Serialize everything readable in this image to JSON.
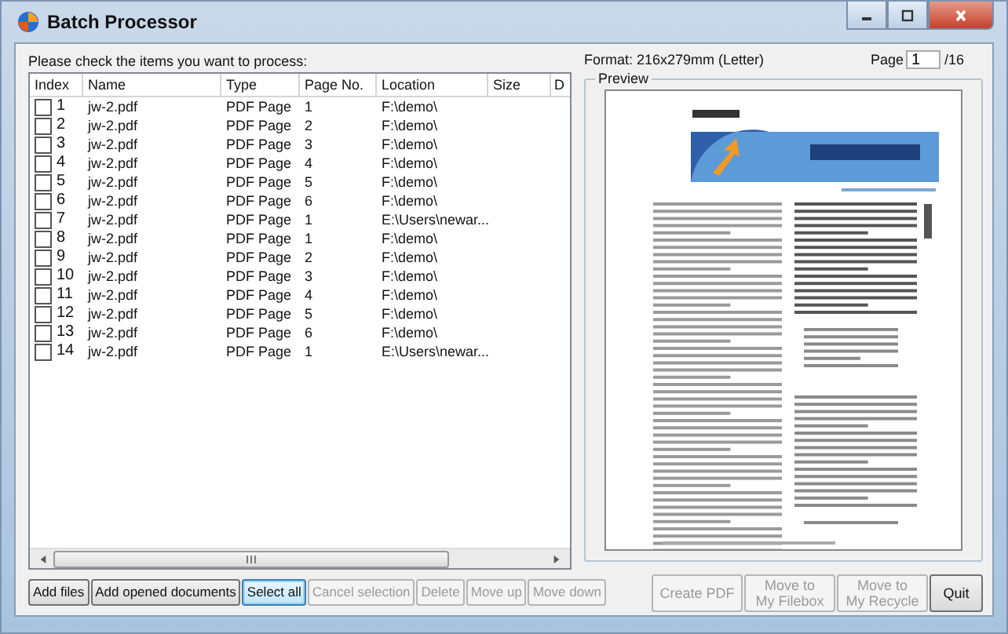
{
  "window": {
    "title": "Batch Processor"
  },
  "instruction": "Please check the items you want to process:",
  "table": {
    "columns": [
      "Index",
      "Name",
      "Type",
      "Page No.",
      "Location",
      "Size",
      "D"
    ],
    "rows": [
      {
        "checked": false,
        "cells": [
          "1",
          "jw-2.pdf",
          "PDF Page",
          "1",
          "F:\\demo\\",
          ""
        ]
      },
      {
        "checked": false,
        "cells": [
          "2",
          "jw-2.pdf",
          "PDF Page",
          "2",
          "F:\\demo\\",
          ""
        ]
      },
      {
        "checked": false,
        "cells": [
          "3",
          "jw-2.pdf",
          "PDF Page",
          "3",
          "F:\\demo\\",
          ""
        ]
      },
      {
        "checked": false,
        "cells": [
          "4",
          "jw-2.pdf",
          "PDF Page",
          "4",
          "F:\\demo\\",
          ""
        ]
      },
      {
        "checked": false,
        "cells": [
          "5",
          "jw-2.pdf",
          "PDF Page",
          "5",
          "F:\\demo\\",
          ""
        ]
      },
      {
        "checked": false,
        "cells": [
          "6",
          "jw-2.pdf",
          "PDF Page",
          "6",
          "F:\\demo\\",
          ""
        ]
      },
      {
        "checked": false,
        "cells": [
          "7",
          "jw-2.pdf",
          "PDF Page",
          "1",
          "E:\\Users\\newar...",
          ""
        ]
      },
      {
        "checked": false,
        "cells": [
          "8",
          "jw-2.pdf",
          "PDF Page",
          "1",
          "F:\\demo\\",
          ""
        ]
      },
      {
        "checked": false,
        "cells": [
          "9",
          "jw-2.pdf",
          "PDF Page",
          "2",
          "F:\\demo\\",
          ""
        ]
      },
      {
        "checked": false,
        "cells": [
          "10",
          "jw-2.pdf",
          "PDF Page",
          "3",
          "F:\\demo\\",
          ""
        ]
      },
      {
        "checked": false,
        "cells": [
          "11",
          "jw-2.pdf",
          "PDF Page",
          "4",
          "F:\\demo\\",
          ""
        ]
      },
      {
        "checked": false,
        "cells": [
          "12",
          "jw-2.pdf",
          "PDF Page",
          "5",
          "F:\\demo\\",
          ""
        ]
      },
      {
        "checked": false,
        "cells": [
          "13",
          "jw-2.pdf",
          "PDF Page",
          "6",
          "F:\\demo\\",
          ""
        ]
      },
      {
        "checked": false,
        "cells": [
          "14",
          "jw-2.pdf",
          "PDF Page",
          "1",
          "E:\\Users\\newar...",
          ""
        ]
      }
    ]
  },
  "list_buttons": [
    {
      "label": "Add files",
      "disabled": false,
      "focused": false
    },
    {
      "label": "Add opened documents",
      "disabled": false,
      "focused": false
    },
    {
      "label": "Select all",
      "disabled": false,
      "focused": true
    },
    {
      "label": "Cancel selection",
      "disabled": true,
      "focused": false
    },
    {
      "label": "Delete",
      "disabled": true,
      "focused": false
    },
    {
      "label": "Move up",
      "disabled": true,
      "focused": false
    },
    {
      "label": "Move down",
      "disabled": true,
      "focused": false
    }
  ],
  "format": "Format: 216x279mm (Letter)",
  "page": {
    "label": "Page",
    "value": "1",
    "total": "/16"
  },
  "preview": {
    "title": "Preview",
    "kind": "picture"
  },
  "action_buttons": [
    {
      "label": "Create PDF",
      "disabled": true
    },
    {
      "label": "Move to\nMy Filebox",
      "disabled": true
    },
    {
      "label": "Move to\nMy Recycle",
      "disabled": true
    },
    {
      "label": "Quit",
      "disabled": false
    }
  ]
}
